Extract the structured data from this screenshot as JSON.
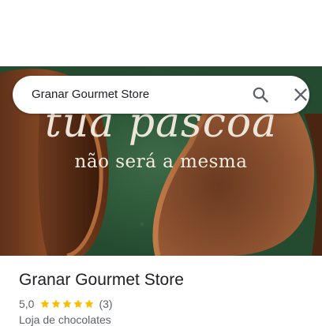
{
  "search": {
    "query": "Granar Gourmet Store"
  },
  "hero": {
    "line1": "tua páscoa",
    "line2": "não será a mesma"
  },
  "place": {
    "name": "Granar Gourmet Store",
    "rating": "5,0",
    "stars": 5,
    "review_count": "(3)",
    "category": "Loja de chocolates"
  },
  "icons": {
    "search": "search-icon",
    "close": "close-icon",
    "star": "star-icon"
  },
  "colors": {
    "star": "#fbbc04",
    "hero_background": "#2f5a3a",
    "chocolate": "#7a4022"
  }
}
